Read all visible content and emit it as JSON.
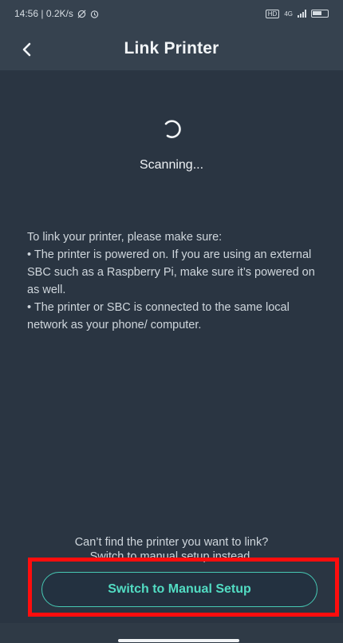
{
  "status_bar": {
    "time_info": "14:56 | 0.2K/s",
    "icons": [
      "alarm-off-icon",
      "alarm-icon",
      "hd-icon",
      "signal-icon",
      "battery-icon"
    ],
    "hd_label": "HD",
    "network_label": "4G"
  },
  "header": {
    "title": "Link Printer",
    "back_icon": "chevron-left-icon"
  },
  "scan": {
    "spinner_icon": "loading-spinner-icon",
    "status_text": "Scanning..."
  },
  "instructions": {
    "intro": "To link your printer, please make sure:",
    "bullets": [
      "• The printer is powered on. If you are using an external SBC such as a Raspberry Pi, make sure it’s powered on as well.",
      "• The printer or SBC is connected to the same local network as your phone/ computer."
    ]
  },
  "footer": {
    "hint_line1": "Can’t find the printer you want to link?",
    "hint_line2": "Switch to manual setup instead.",
    "manual_button_label": "Switch to Manual Setup"
  },
  "colors": {
    "background": "#2a3542",
    "app_bar": "#36424f",
    "accent": "#46c8b4",
    "highlight": "#ff0d0d"
  }
}
